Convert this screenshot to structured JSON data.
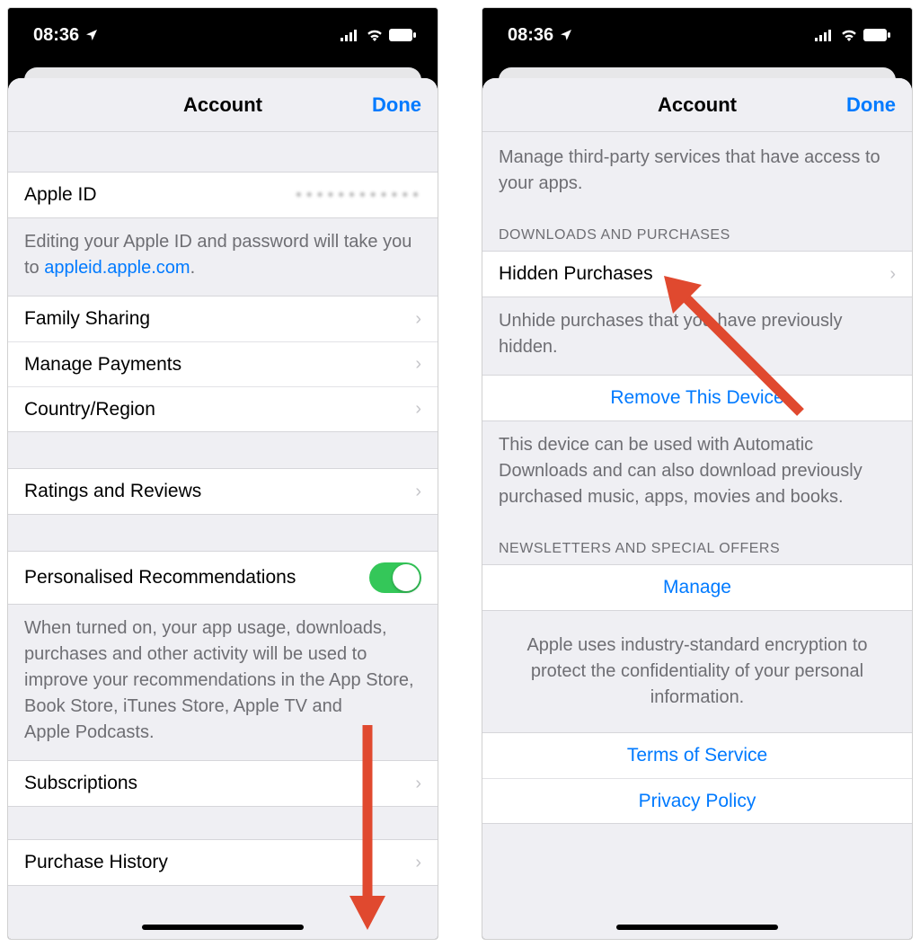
{
  "status": {
    "time": "08:36"
  },
  "nav": {
    "title": "Account",
    "done": "Done"
  },
  "screen1": {
    "apple_id_label": "Apple ID",
    "apple_id_value": "••••••••••••",
    "apple_id_footer_pre": "Editing your Apple ID and password will take you to ",
    "apple_id_footer_link": "appleid.apple.com",
    "apple_id_footer_post": ".",
    "family_sharing": "Family Sharing",
    "manage_payments": "Manage Payments",
    "country_region": "Country/Region",
    "ratings_reviews": "Ratings and Reviews",
    "personalised_recs": "Personalised Recommendations",
    "personalised_footer": "When turned on, your app usage, downloads, purchases and other activity will be used to improve your recommendations in the App Store, Book Store, iTunes Store, Apple TV and Apple Podcasts.",
    "subscriptions": "Subscriptions",
    "purchase_history": "Purchase History"
  },
  "screen2": {
    "manage_third_party": "Manage third-party services that have access to your apps.",
    "downloads_header": "Downloads and Purchases",
    "hidden_purchases": "Hidden Purchases",
    "hidden_footer": "Unhide purchases that you have previously hidden.",
    "remove_device": "Remove This Device",
    "remove_device_footer": "This device can be used with Automatic Downloads and can also download previously purchased music, apps, movies and books.",
    "newsletters_header": "Newsletters and Special Offers",
    "manage": "Manage",
    "encryption_footer": "Apple uses industry-standard encryption to protect the confidentiality of your personal information.",
    "terms": "Terms of Service",
    "privacy": "Privacy Policy"
  }
}
